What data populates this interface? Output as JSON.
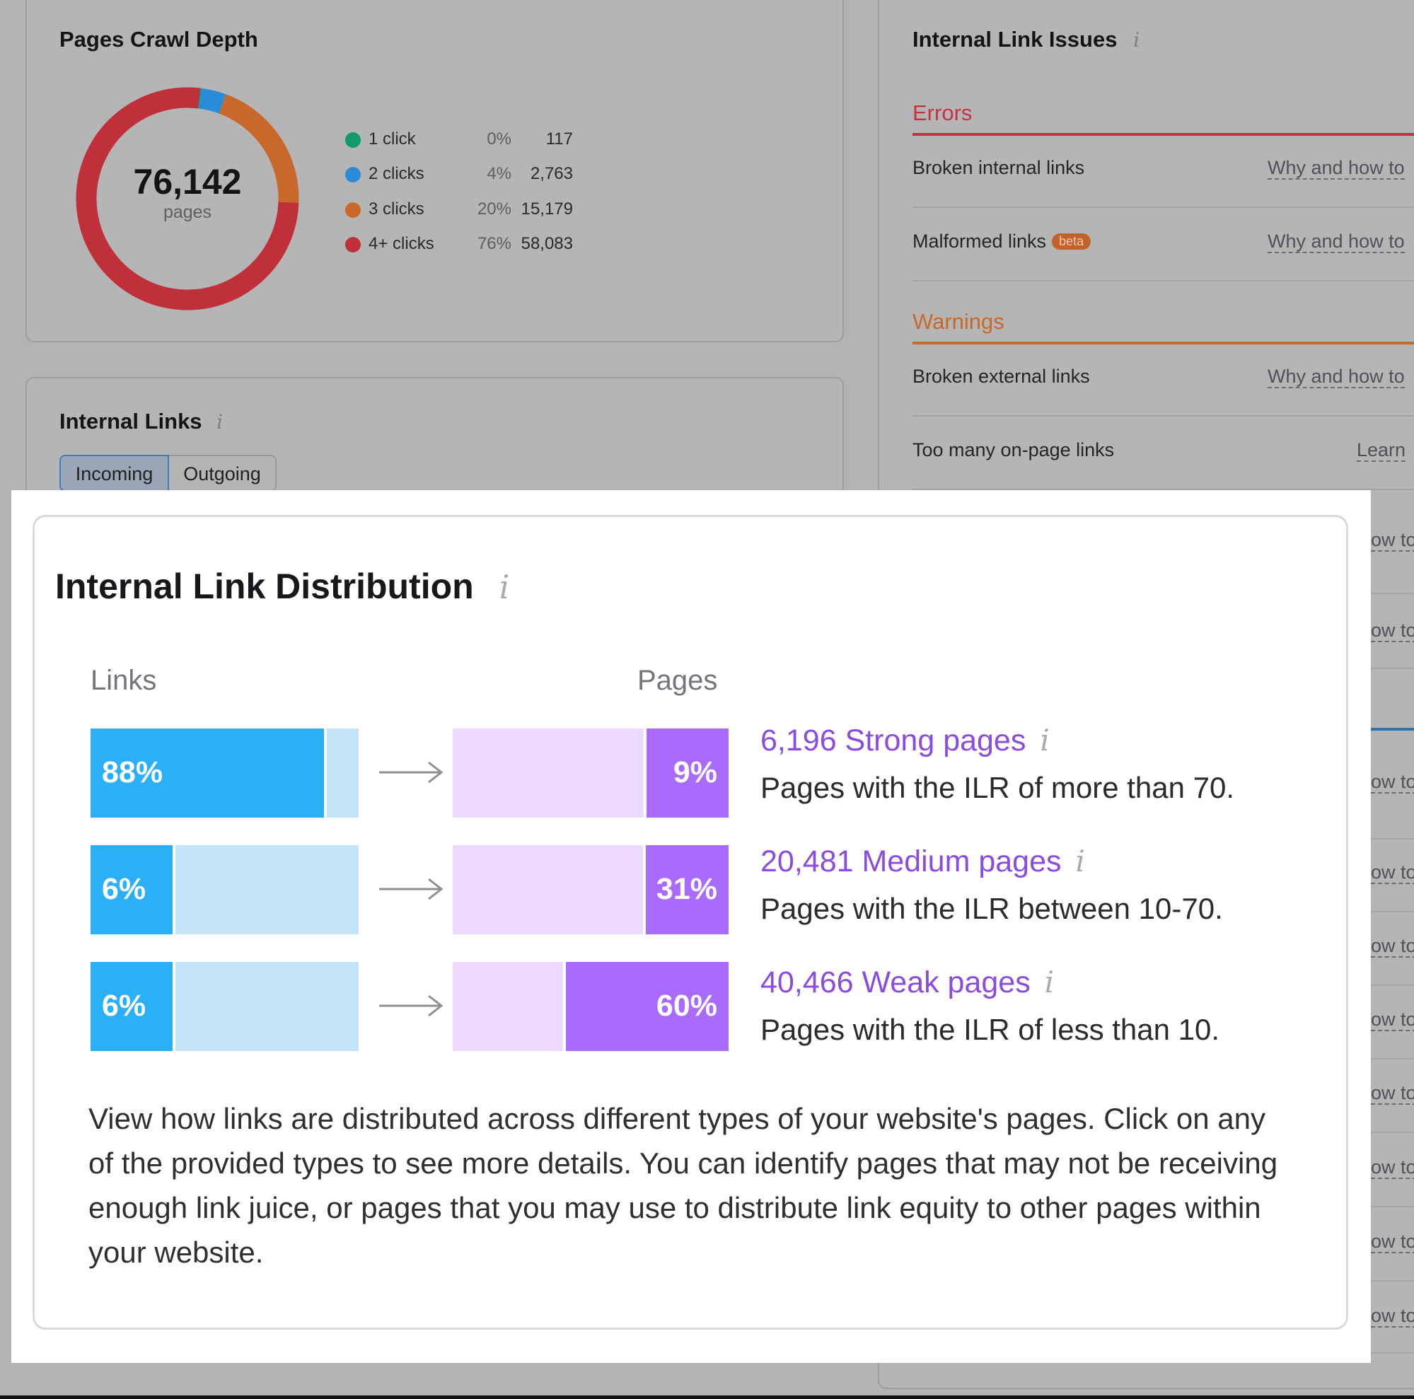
{
  "crawl_depth": {
    "title": "Pages Crawl Depth",
    "total": "76,142",
    "total_label": "pages",
    "legend": [
      {
        "label": "1 click",
        "pct": "0%",
        "value": "117",
        "color": "#0f9b6a"
      },
      {
        "label": "2 clicks",
        "pct": "4%",
        "value": "2,763",
        "color": "#2a8cd8"
      },
      {
        "label": "3 clicks",
        "pct": "20%",
        "value": "15,179",
        "color": "#c8682a"
      },
      {
        "label": "4+ clicks",
        "pct": "76%",
        "value": "58,083",
        "color": "#c0303a"
      }
    ]
  },
  "internal_links": {
    "title": "Internal Links",
    "info_icon": "i",
    "tabs": [
      {
        "label": "Incoming",
        "active": true
      },
      {
        "label": "Outgoing",
        "active": false
      }
    ]
  },
  "issues": {
    "title": "Internal Link Issues",
    "info_icon": "i",
    "errors_label": "Errors",
    "errors_color": "#c6323f",
    "warnings_label": "Warnings",
    "warnings_color": "#c8682a",
    "rows": [
      {
        "name": "Broken internal links",
        "link": "Why and how to"
      },
      {
        "name": "Malformed links",
        "badge": "beta",
        "link": "Why and how to"
      },
      {
        "name": "Broken external links",
        "link": "Why and how to"
      },
      {
        "name": "Too many on-page links",
        "link": "Learn"
      }
    ],
    "truncated_link": "ow to"
  },
  "distribution": {
    "title": "Internal Link Distribution",
    "info_icon": "i",
    "links_header": "Links",
    "pages_header": "Pages",
    "rows": [
      {
        "links_pct_label": "88%",
        "links_pct": 88,
        "pages_pct_label": "9%",
        "pages_pct": 9,
        "head": "6,196 Strong pages",
        "sub": "Pages with the ILR of more than 70."
      },
      {
        "links_pct_label": "6%",
        "links_pct": 6,
        "pages_pct_label": "31%",
        "pages_pct": 31,
        "head": "20,481 Medium pages",
        "sub": "Pages with the ILR between 10-70."
      },
      {
        "links_pct_label": "6%",
        "links_pct": 6,
        "pages_pct_label": "60%",
        "pages_pct": 60,
        "head": "40,466 Weak pages",
        "sub": "Pages with the ILR of less than 10."
      }
    ],
    "paragraph": "View how links are distributed across different types of your website's pages. Click on any of the provided types to see more details. You can identify pages that may not be receiving enough link juice, or pages that you may use to distribute link equity to other pages within your website."
  }
}
